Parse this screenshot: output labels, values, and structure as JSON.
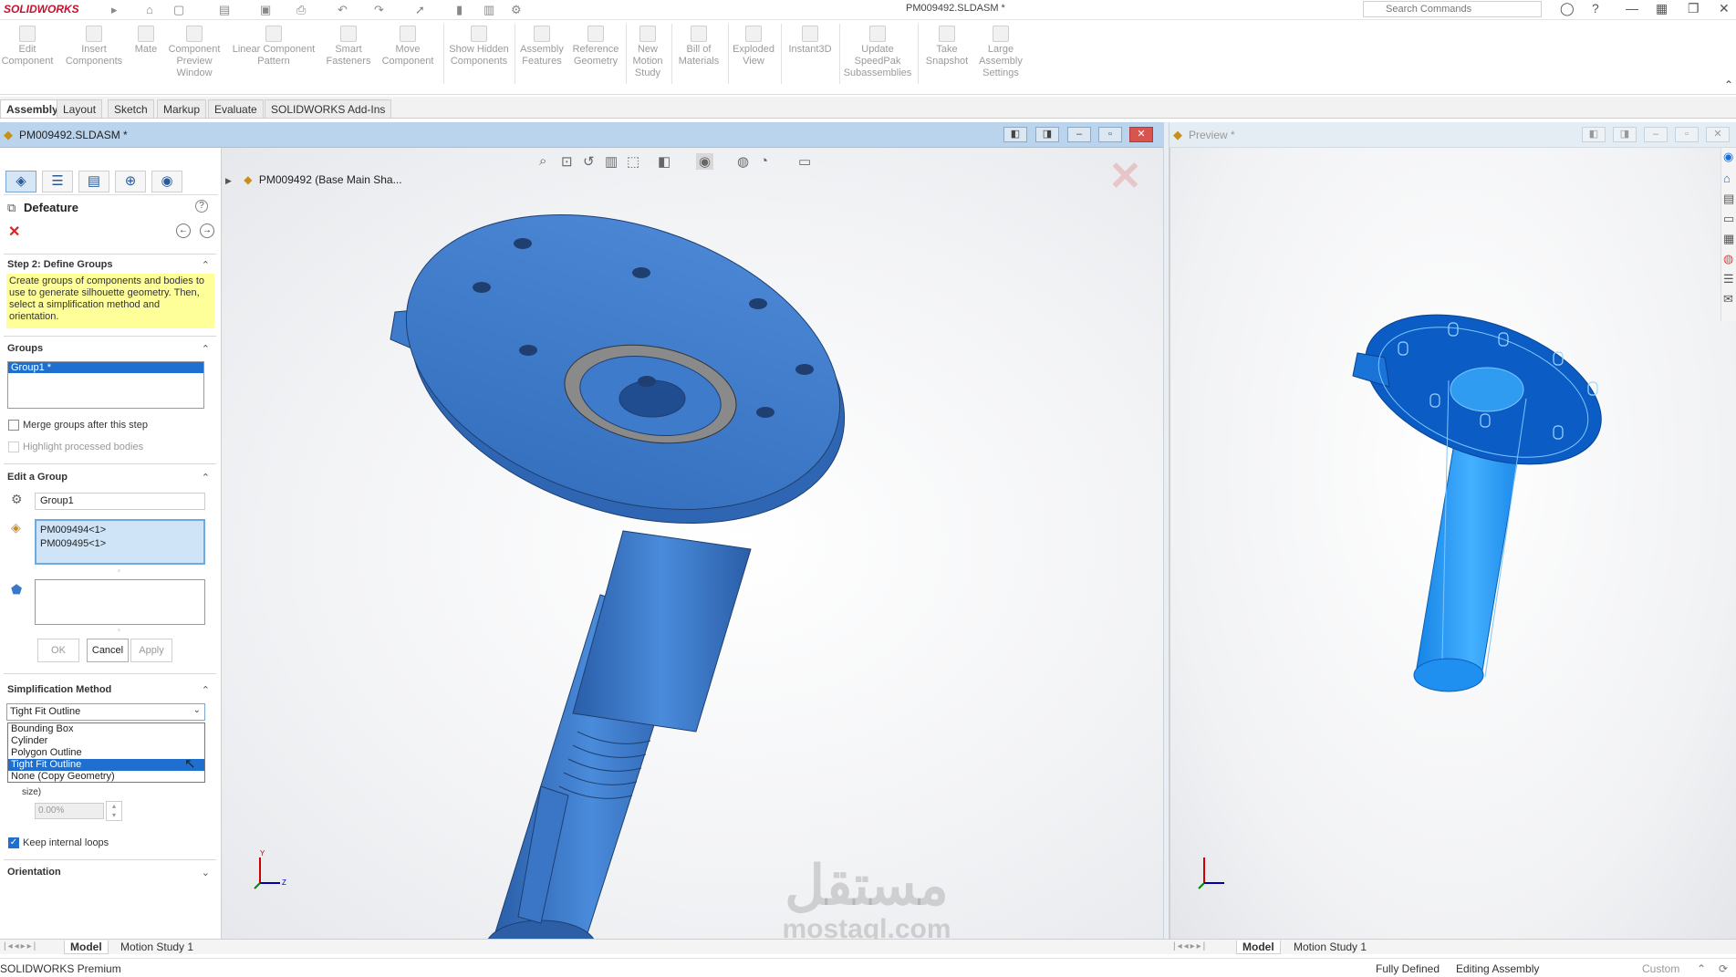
{
  "app": {
    "logo": "SOLIDWORKS",
    "window_title": "PM009492.SLDASM *"
  },
  "search": {
    "placeholder": "Search Commands"
  },
  "ribbon": {
    "buttons": [
      {
        "label": "Edit Component"
      },
      {
        "label": "Insert Components"
      },
      {
        "label": "Mate"
      },
      {
        "label": "Component Preview Window"
      },
      {
        "label": "Linear Component Pattern"
      },
      {
        "label": "Smart Fasteners"
      },
      {
        "label": "Move Component"
      },
      {
        "label": "Show Hidden Components"
      },
      {
        "label": "Assembly Features"
      },
      {
        "label": "Reference Geometry"
      },
      {
        "label": "New Motion Study"
      },
      {
        "label": "Bill of Materials"
      },
      {
        "label": "Exploded View"
      },
      {
        "label": "Instant3D"
      },
      {
        "label": "Update SpeedPak Subassemblies"
      },
      {
        "label": "Take Snapshot"
      },
      {
        "label": "Large Assembly Settings"
      }
    ]
  },
  "tabs": [
    "Assembly",
    "Layout",
    "Sketch",
    "Markup",
    "Evaluate",
    "SOLIDWORKS Add-Ins"
  ],
  "doc": {
    "title": "PM009492.SLDASM *",
    "preview_title": "Preview *"
  },
  "property_manager": {
    "title": "Defeature",
    "step": {
      "heading": "Step 2: Define Groups",
      "hint": "Create groups of components and bodies to use to generate silhouette geometry. Then, select a simplification method and orientation."
    },
    "groups": {
      "heading": "Groups",
      "items": [
        "Group1 *"
      ],
      "merge_label": "Merge groups after this step",
      "highlight_label": "Highlight processed bodies"
    },
    "edit_group": {
      "heading": "Edit a Group",
      "name_value": "Group1",
      "components": [
        "PM009494<1>",
        "PM009495<1>"
      ]
    },
    "buttons": {
      "ok": "OK",
      "cancel": "Cancel",
      "apply": "Apply"
    },
    "simplification": {
      "heading": "Simplification Method",
      "selected": "Tight Fit Outline",
      "options": [
        "Bounding Box",
        "Cylinder",
        "Polygon Outline",
        "Tight Fit Outline",
        "None (Copy Geometry)"
      ],
      "hidden_label": "size)",
      "percent_value": "0.00%",
      "keep_loops_label": "Keep internal loops"
    },
    "orientation": {
      "heading": "Orientation"
    }
  },
  "tree": {
    "root": "PM009492 (Base Main Sha..."
  },
  "bottom_tabs": {
    "left": [
      "Model",
      "Motion Study 1"
    ],
    "right": [
      "Model",
      "Motion Study 1"
    ]
  },
  "status": {
    "product": "SOLIDWORKS Premium",
    "state": "Fully Defined",
    "mode": "Editing Assembly",
    "units": "Custom"
  },
  "watermark": {
    "line1": "مستقل",
    "line2": "mostaql.com"
  },
  "colors": {
    "accent": "#1e6fd0",
    "part_blue": "#3a78c9",
    "preview_blue": "#1e8ff0",
    "hint_yellow": "#ffff99"
  }
}
